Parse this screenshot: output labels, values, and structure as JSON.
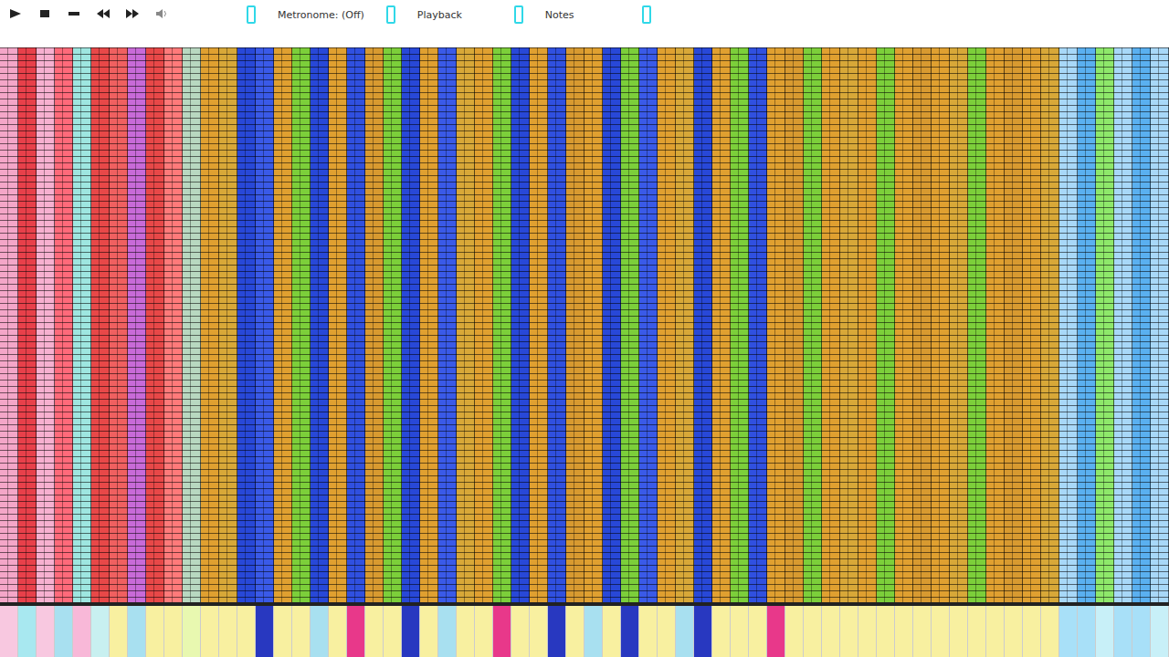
{
  "toolbar": {
    "buttons": [
      {
        "kind": "play"
      },
      {
        "kind": "stop"
      },
      {
        "kind": "record"
      },
      {
        "kind": "rewind"
      },
      {
        "kind": "forward"
      },
      {
        "kind": "volume"
      }
    ],
    "controls": [
      {
        "label": "Metronome: (Off)"
      },
      {
        "label": "Playback"
      },
      {
        "label": "Notes"
      }
    ]
  },
  "roll": {
    "columns": [
      "#f4a6c8",
      "#e8404a",
      "#f7b0d0",
      "#ff6a7a",
      "#9ee6e0",
      "#e84848",
      "#f06060",
      "#c86ad8",
      "#e84848",
      "#ff7a7a",
      "#b8d8c0",
      "#e0a030",
      "#d8a838",
      "#2848d8",
      "#3a5ae8",
      "#e0a030",
      "#7ccf3a",
      "#2848d8",
      "#e0a030",
      "#3050e0",
      "#d89a30",
      "#7ccf3a",
      "#2848d8",
      "#e0a030",
      "#3a5ae8",
      "#d8a838",
      "#e0a030",
      "#7ccf3a",
      "#2848d8",
      "#e0a030",
      "#3050e0",
      "#d89a30",
      "#e0a030",
      "#2848d8",
      "#7ccf3a",
      "#3a5ae8",
      "#e0a030",
      "#d8a838",
      "#2848d8",
      "#e0a030",
      "#7ccf3a",
      "#3050e0",
      "#e0a030",
      "#d89a30",
      "#7ccf3a",
      "#e0a030",
      "#d8a838",
      "#e0a030",
      "#7ccf3a",
      "#e0a030",
      "#d89a30",
      "#e0a030",
      "#d8a838",
      "#7ccf3a",
      "#e0a030",
      "#d89a30",
      "#e0a030",
      "#d8a838",
      "#a8d8f8",
      "#5ab0f0",
      "#8ee86a",
      "#a8d8f8",
      "#5ab0f0",
      "#a8d8f8"
    ]
  },
  "keyboard": {
    "keys": [
      "#f8c8e0",
      "#a8e8f0",
      "#f8c8e0",
      "#a8e0f0",
      "#f8b8d8",
      "#c8f0f0",
      "#f8f0a0",
      "#a8e0f0",
      "#f8f0a0",
      "#f8f0a0",
      "#e8f8b0",
      "#f8f0a0",
      "#f8f0a0",
      "#f8f0a0",
      "#2838c0",
      "#f8f0a0",
      "#f8f0a0",
      "#a8e0f0",
      "#f8f0a0",
      "#e8388a",
      "#f8f0a0",
      "#f8f0a0",
      "#2838c0",
      "#f8f0a0",
      "#a8e0f0",
      "#f8f0a0",
      "#f8f0a0",
      "#e8388a",
      "#f8f0a0",
      "#f8f0a0",
      "#2838c0",
      "#f8f0a0",
      "#a8e0f0",
      "#f8f0a0",
      "#2838c0",
      "#f8f0a0",
      "#f8f0a0",
      "#a8e0f0",
      "#2838c0",
      "#f8f0a0",
      "#f8f0a0",
      "#f8f0a0",
      "#e8388a",
      "#f8f0a0",
      "#f8f0a0",
      "#f8f0a0",
      "#f8f0a0",
      "#f8f0a0",
      "#f8f0a0",
      "#f8f0a0",
      "#f8f0a0",
      "#f8f0a0",
      "#f8f0a0",
      "#f8f0a0",
      "#f8f0a0",
      "#f8f0a0",
      "#f8f0a0",
      "#f8f0a0",
      "#a8e0f8",
      "#a8e0f8",
      "#c8f0f8",
      "#a8e0f8",
      "#a8e0f8",
      "#c8f0f8"
    ]
  }
}
